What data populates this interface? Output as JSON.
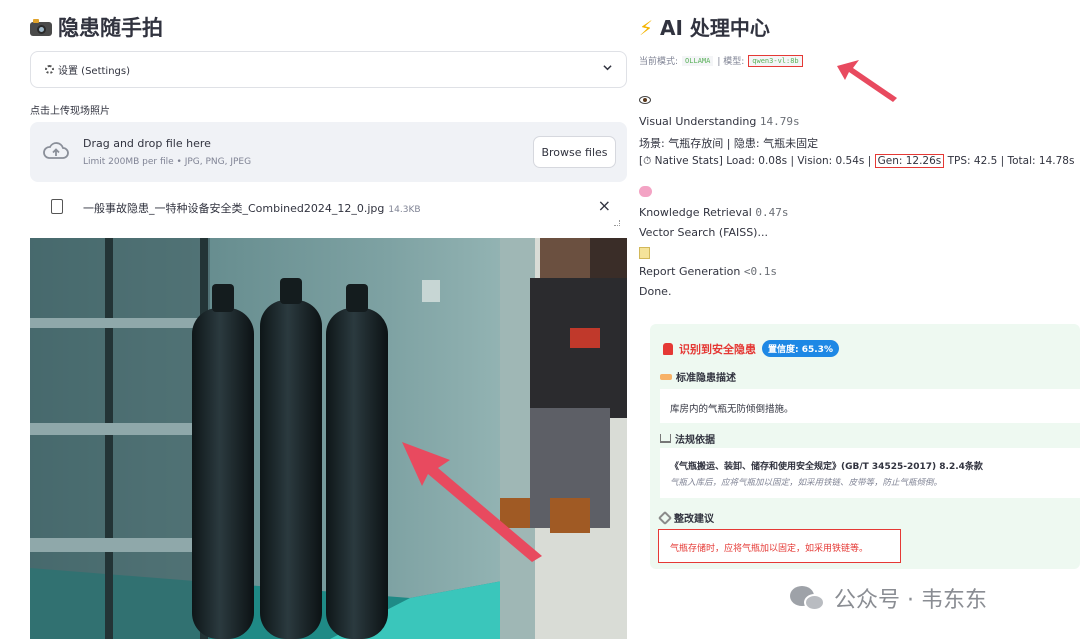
{
  "left": {
    "title": "隐患随手拍",
    "settings_label": "设置 (Settings)",
    "upload_label": "点击上传现场照片",
    "dropzone": {
      "title": "Drag and drop file here",
      "subtitle": "Limit 200MB per file • JPG, PNG, JPEG",
      "browse_label": "Browse files"
    },
    "file": {
      "name": "一般事故隐患_一特种设备安全类_Combined2024_12_0.jpg",
      "size": "14.3KB",
      "close_symbol": "×"
    }
  },
  "right": {
    "title": "AI 处理中心",
    "mode_label": "当前模式:",
    "mode_value": "OLLAMA",
    "model_label": "| 模型:",
    "model_value": "qwen3-vl:8b",
    "visual": {
      "label": "Visual Understanding",
      "time": "14.79s",
      "scene": "场景: 气瓶存放间 | 隐患: 气瓶未固定",
      "stats_prefix": "[⏱ Native Stats] Load: 0.08s | Vision: 0.54s |",
      "stats_gen": "Gen: 12.26s",
      "stats_suffix": "TPS: 42.5 | Total: 14.78s"
    },
    "knowledge": {
      "label": "Knowledge Retrieval",
      "time": "0.47s",
      "vector": "Vector Search (FAISS)..."
    },
    "report": {
      "label": "Report Generation",
      "time": "<0.1s",
      "done": "Done."
    },
    "card": {
      "title": "识别到安全隐患",
      "confidence": "置信度: 65.3%",
      "desc_title": "标准隐患描述",
      "desc_text": "库房内的气瓶无防倾倒措施。",
      "law_title": "法规依据",
      "law_text": "《气瓶搬运、装卸、储存和使用安全规定》(GB/T 34525-2017) 8.2.4条款",
      "law_sub": "气瓶入库后，应将气瓶加以固定，如采用铁链、皮带等，防止气瓶倾倒。",
      "suggest_title": "整改建议",
      "suggest_text": "气瓶存储时，应将气瓶加以固定，如采用铁链等。"
    }
  },
  "watermark": "公众号 · 韦东东",
  "colors": {
    "accent_red": "#e53935",
    "badge_blue": "#1e88e5",
    "card_bg": "#eef9f1",
    "code_green": "#5ab25a"
  },
  "icons": [
    "camera-icon",
    "gear-icon",
    "chevron-down-icon",
    "cloud-upload-icon",
    "file-icon",
    "close-icon",
    "lightning-icon",
    "eye-icon",
    "brain-icon",
    "memo-icon",
    "alarm-icon",
    "tag-icon",
    "scale-icon",
    "tools-icon",
    "wechat-icon"
  ]
}
